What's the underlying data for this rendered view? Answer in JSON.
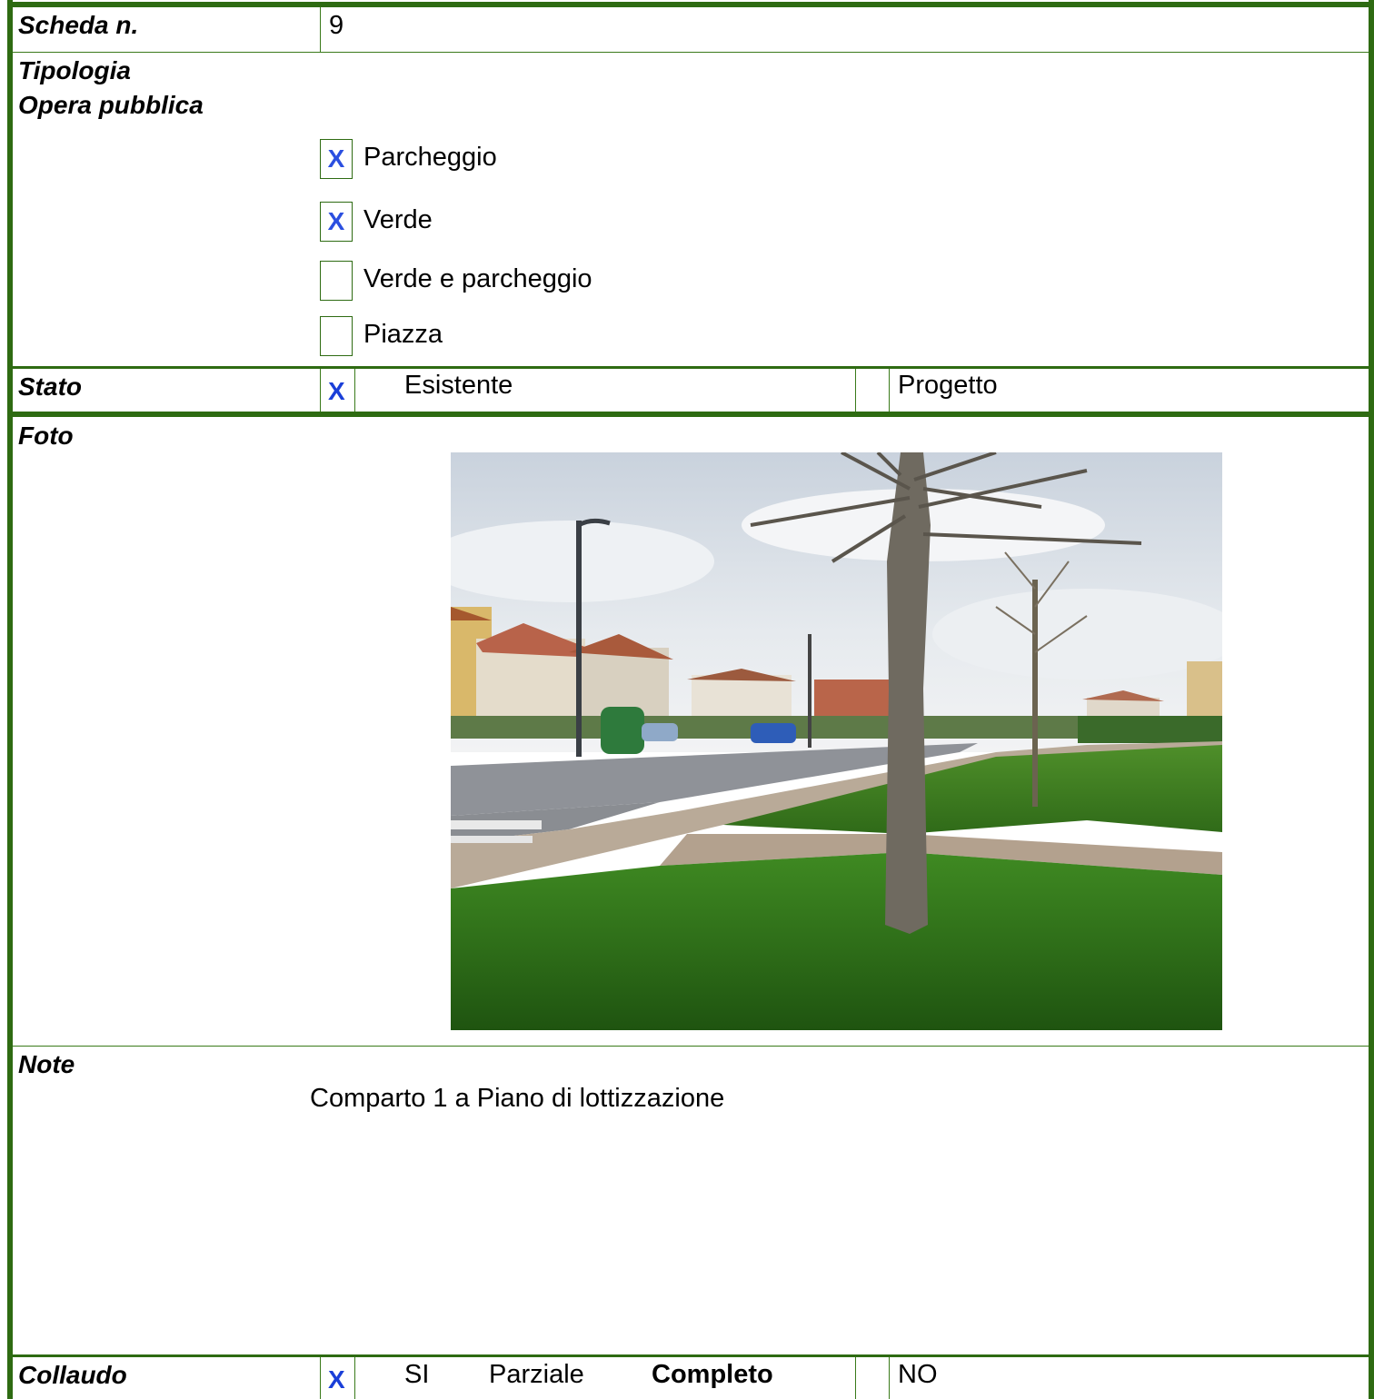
{
  "scheda": {
    "label": "Scheda n.",
    "value": "9"
  },
  "tipologia": {
    "label1": "Tipologia",
    "label2": "Opera pubblica",
    "options": [
      {
        "label": "Parcheggio",
        "mark": "X"
      },
      {
        "label": "Verde",
        "mark": "X"
      },
      {
        "label": "Verde e parcheggio",
        "mark": ""
      },
      {
        "label": "Piazza",
        "mark": ""
      }
    ]
  },
  "stato": {
    "label": "Stato",
    "mark": "X",
    "option1": "Esistente",
    "option2": "Progetto"
  },
  "foto": {
    "label": "Foto"
  },
  "note": {
    "label": "Note",
    "text": "Comparto 1 a Piano di lottizzazione"
  },
  "collaudo": {
    "label": "Collaudo",
    "mark": "X",
    "si": "SI",
    "parziale": "Parziale",
    "completo": "Completo",
    "no": "NO"
  },
  "colors": {
    "border": "#2e6b12",
    "check": "#2b4fe0"
  }
}
